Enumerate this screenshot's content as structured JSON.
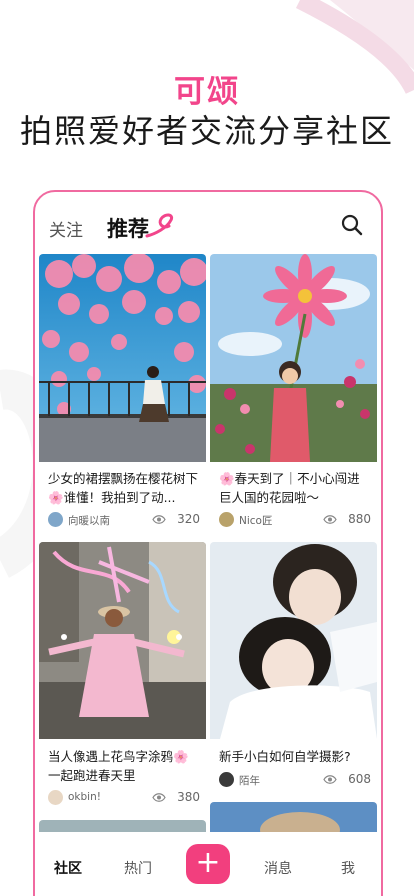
{
  "hero": {
    "title": "可颂",
    "subtitle": "拍照爱好者交流分享社区"
  },
  "tabs": {
    "follow": "关注",
    "recommend": "推荐"
  },
  "feed": {
    "cards": [
      {
        "title": "少女的裙摆飘扬在樱花树下🌸谁懂！我拍到了动...",
        "author": "向暖以南",
        "views": "320"
      },
      {
        "title": "🌸春天到了｜不小心闯进巨人国的花园啦～",
        "author": "Nico匠",
        "views": "880"
      },
      {
        "title": "当人像遇上花鸟字涂鸦🌸一起跑进春天里",
        "author": "okbin!",
        "views": "380"
      },
      {
        "title": "新手小白如何自学摄影?",
        "author": "陌年",
        "views": "608"
      }
    ]
  },
  "bottom_nav": {
    "community": "社区",
    "hot": "热门",
    "add": "+",
    "messages": "消息",
    "me": "我"
  },
  "colors": {
    "accent": "#f2458b",
    "add_button": "#f23f7e",
    "border": "#f06aa0"
  },
  "icons": {
    "search": "search-icon",
    "views": "eye-icon"
  }
}
